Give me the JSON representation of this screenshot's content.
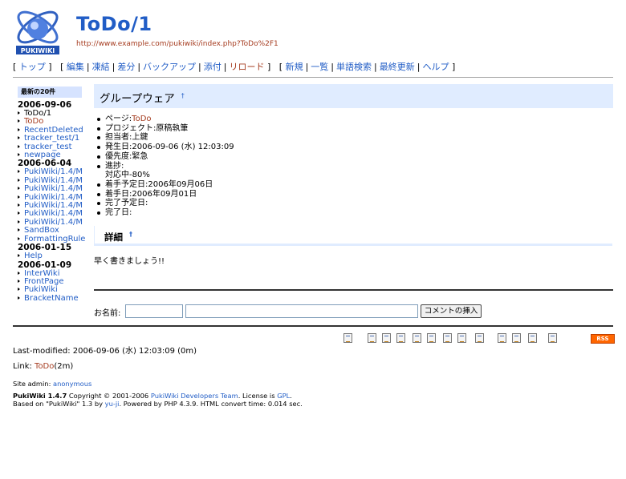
{
  "header": {
    "title": "ToDo/1",
    "url": "http://www.example.com/pukiwiki/index.php?ToDo%2F1",
    "logo_text": "PUKIWIKI"
  },
  "nav": {
    "group1": [
      "トップ"
    ],
    "group2": [
      "編集",
      "凍結",
      "差分",
      "バックアップ",
      "添付",
      "リロード"
    ],
    "group3": [
      "新規",
      "一覧",
      "単語検索",
      "最終更新",
      "ヘルプ"
    ]
  },
  "menubar": {
    "title": "最新の20件",
    "sections": [
      {
        "date": "2006-09-06",
        "items": [
          {
            "label": "ToDo/1",
            "current": true
          },
          {
            "label": "ToDo",
            "current": false,
            "visited": true
          },
          {
            "label": "RecentDeleted"
          },
          {
            "label": "tracker_test/1"
          },
          {
            "label": "tracker_test"
          },
          {
            "label": "newpage"
          }
        ]
      },
      {
        "date": "2006-06-04",
        "items": [
          {
            "label": "PukiWiki/1.4/M"
          },
          {
            "label": "PukiWiki/1.4/M"
          },
          {
            "label": "PukiWiki/1.4/M"
          },
          {
            "label": "PukiWiki/1.4/M"
          },
          {
            "label": "PukiWiki/1.4/M"
          },
          {
            "label": "PukiWiki/1.4/M"
          },
          {
            "label": "PukiWiki/1.4/M"
          },
          {
            "label": "SandBox"
          },
          {
            "label": "FormattingRule"
          }
        ]
      },
      {
        "date": "2006-01-15",
        "items": [
          {
            "label": "Help"
          }
        ]
      },
      {
        "date": "2006-01-09",
        "items": [
          {
            "label": "InterWiki"
          },
          {
            "label": "FrontPage"
          },
          {
            "label": "PukiWiki"
          },
          {
            "label": "BracketName"
          }
        ]
      }
    ]
  },
  "content": {
    "heading": "グループウェア",
    "anchor": "†",
    "props": {
      "page_label": "ページ:",
      "page_link": "ToDo",
      "project": "プロジェクト:原稿執筆",
      "owner": "担当者:上鍵",
      "created": "発生日:2006-09-06 (水) 12:03:09",
      "priority": "優先度:緊急",
      "progress_label": "進捗:",
      "progress_value": "対応中-80%",
      "start_plan": "着手予定日:2006年09月06日",
      "start": "着手日:2006年09月01日",
      "done_plan": "完了予定日:",
      "done": "完了日:"
    },
    "detail_heading": "詳細",
    "detail_text": "早く書きましょう!!"
  },
  "comment": {
    "name_label": "お名前:",
    "name_value": "",
    "msg_value": "",
    "submit_label": "コメントの挿入"
  },
  "toolbar": {
    "icons": [
      "top-icon",
      "edit-icon",
      "freeze-icon",
      "diff-icon",
      "backup-icon",
      "upload-icon",
      "copy-icon",
      "reload-icon",
      "new-icon",
      "list-icon",
      "search-icon",
      "recent-icon",
      "help-icon",
      "rss-icon"
    ],
    "rss_label": "RSS"
  },
  "lastmodified": "Last-modified: 2006-09-06 (水) 12:03:09 (0m)",
  "related": {
    "label": "Link: ",
    "link": "ToDo",
    "age": "(2m)"
  },
  "footer": {
    "admin_label": "Site admin: ",
    "admin_link": "anonymous",
    "line1_a": "PukiWiki 1.4.7",
    "line1_b": " Copyright © 2001-2006 ",
    "line1_c": "PukiWiki Developers Team",
    "line1_d": ". License is ",
    "line1_e": "GPL",
    "line1_f": ".",
    "line2_a": "Based on \"PukiWiki\" 1.3 by ",
    "line2_b": "yu-ji",
    "line2_c": ". Powered by PHP 4.3.9. HTML convert time: 0.014 sec."
  },
  "colors": {
    "link": "#215dc6",
    "visited_link": "#a63d21",
    "heading_bg": "#e0ecff",
    "menu_title_bg": "#d6e3ff",
    "rss_bg": "#ff6600"
  }
}
